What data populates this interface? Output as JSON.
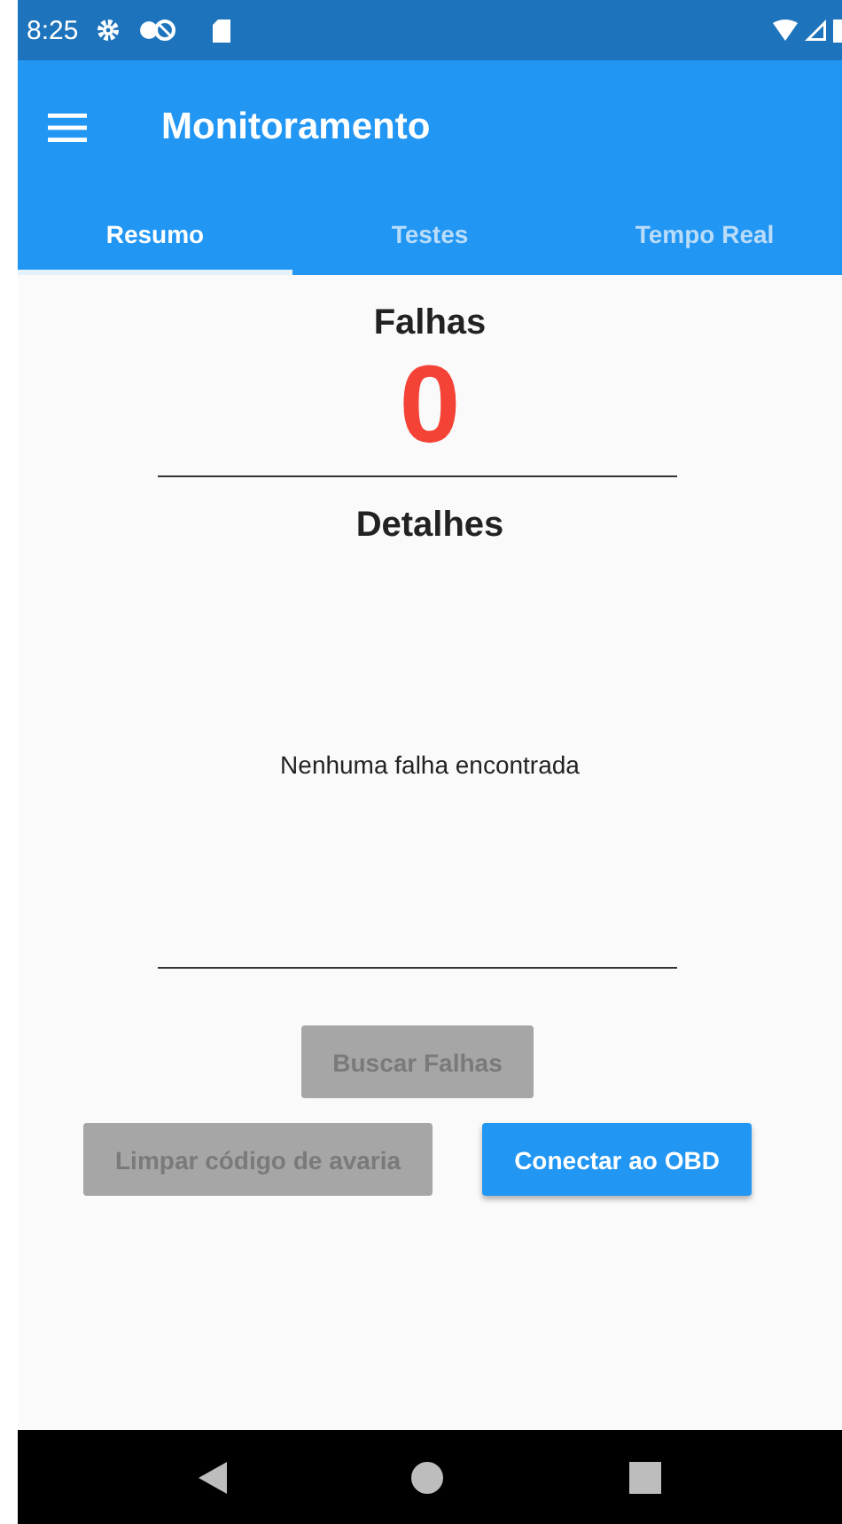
{
  "status_bar": {
    "time": "8:25"
  },
  "app_bar": {
    "title": "Monitoramento"
  },
  "tabs": [
    {
      "label": "Resumo",
      "selected": true
    },
    {
      "label": "Testes",
      "selected": false
    },
    {
      "label": "Tempo Real",
      "selected": false
    }
  ],
  "summary": {
    "heading": "Falhas",
    "count": "0",
    "details_heading": "Detalhes",
    "message": "Nenhuma falha encontrada"
  },
  "buttons": [
    {
      "label": "Buscar Falhas",
      "disabled": true
    },
    {
      "label": "Limpar código de avaria",
      "disabled": true
    },
    {
      "label": "Conectar ao OBD",
      "disabled": false
    }
  ]
}
